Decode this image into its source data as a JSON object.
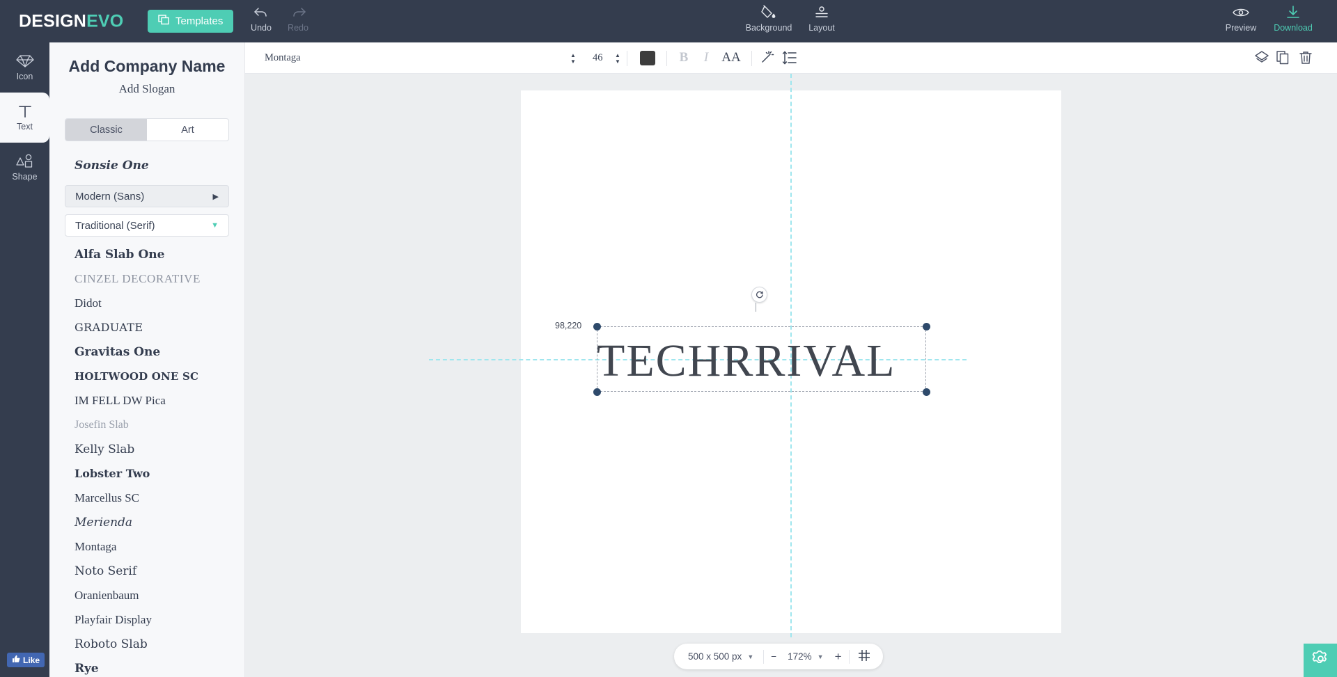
{
  "brand": {
    "name_white": "DESIGN",
    "name_accent": "EVO",
    "accent_color": "#4ecdb4"
  },
  "topbar": {
    "templates_label": "Templates",
    "undo_label": "Undo",
    "redo_label": "Redo",
    "background_label": "Background",
    "layout_label": "Layout",
    "preview_label": "Preview",
    "download_label": "Download",
    "bar_color": "#343d4e"
  },
  "rail": {
    "items": [
      {
        "label": "Icon",
        "icon": "gem-icon",
        "active": false
      },
      {
        "label": "Text",
        "icon": "text-t-icon",
        "active": true
      },
      {
        "label": "Shape",
        "icon": "shapes-icon",
        "active": false
      }
    ]
  },
  "panel": {
    "company_name_placeholder": "Add Company Name",
    "slogan_placeholder": "Add Slogan",
    "tabs": [
      {
        "label": "Classic",
        "selected": true
      },
      {
        "label": "Art",
        "selected": false
      }
    ],
    "top_font": "Sonsie One",
    "groups": [
      {
        "label": "Modern (Sans)",
        "expanded": false,
        "arrow": "chevron-right-icon"
      },
      {
        "label": "Traditional (Serif)",
        "expanded": true,
        "arrow": "chevron-down-icon"
      }
    ],
    "fonts": [
      "Alfa Slab One",
      "CINZEL DECORATIVE",
      "Didot",
      "GRADUATE",
      "Gravitas One",
      "HOLTWOOD ONE SC",
      "IM FELL DW Pica",
      "Josefin Slab",
      "Kelly Slab",
      "Lobster Two",
      "Marcellus SC",
      "Merienda",
      "Montaga",
      "Noto Serif",
      "Oranienbaum",
      "Playfair Display",
      "Roboto Slab",
      "Rye"
    ]
  },
  "format_toolbar": {
    "font_family": "Montaga",
    "font_size": "46",
    "text_color": "#3d3d3d",
    "bold_label": "B",
    "italic_label": "I",
    "case_label": "AA",
    "effects_icon": "magic-wand-icon",
    "spacing_icon": "line-spacing-icon",
    "layers_icon": "layers-icon",
    "duplicate_icon": "duplicate-icon",
    "delete_icon": "trash-icon"
  },
  "canvas": {
    "logo_text": "TECHRRIVAL",
    "coordinates_label": "98,220",
    "guide_color": "#9fe6ee",
    "handle_color": "#2e4a6b",
    "rotate_icon": "rotate-handle-icon"
  },
  "bottombar": {
    "canvas_size": "500 x 500 px",
    "zoom_out_label": "−",
    "zoom_level": "172%",
    "zoom_in_label": "+",
    "grid_icon": "grid-icon"
  },
  "footer": {
    "like_label": "Like",
    "like_icon": "thumbs-up-icon",
    "settings_icon": "gear-icon"
  }
}
